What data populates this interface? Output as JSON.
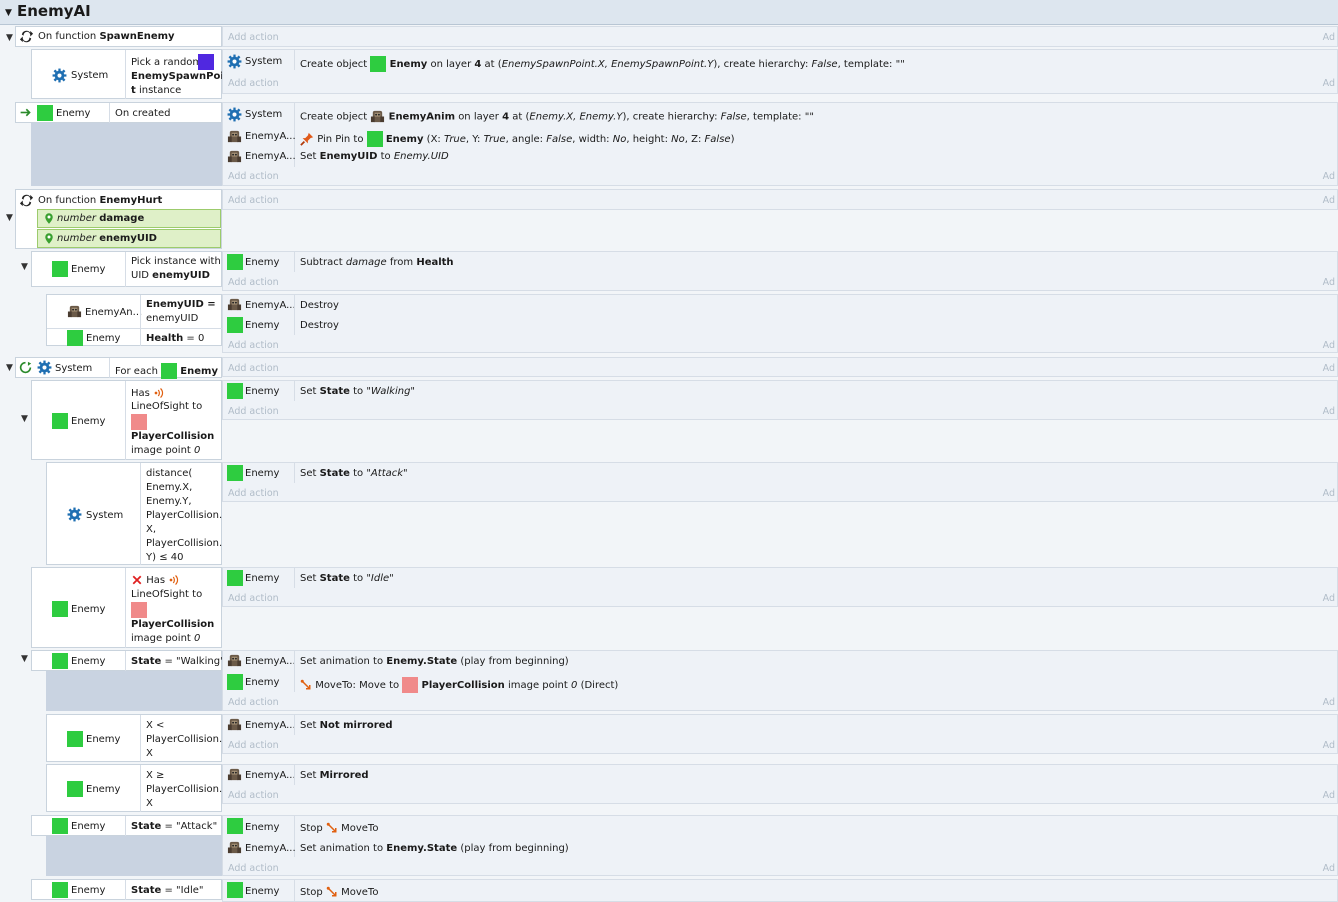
{
  "sheet": {
    "title": "EnemyAI"
  },
  "labels": {
    "add_action": "Add action",
    "add_short": "Ad"
  },
  "objects": {
    "system": "System",
    "enemy": "Enemy",
    "enemy_anim_short": "EnemyA...",
    "enemy_anim_cond": "EnemyAn..."
  },
  "colors": {
    "enemy": "#2ecc40",
    "player_collision": "#f08a8a",
    "spawn_point": "#5028e0",
    "param_bg": "#dff0c8"
  },
  "events": {
    "spawn_fn": {
      "label": "On function",
      "name": "SpawnEnemy"
    },
    "spawn_pick": {
      "pre": "Pick a random",
      "obj": "EnemySpawnPoin",
      "obj2": "t",
      "post": "instance"
    },
    "spawn_action": {
      "pre": "Create object",
      "obj": "Enemy",
      "mid": "on layer",
      "layer": "4",
      "at": "at (",
      "expr": "EnemySpawnPoint.X, EnemySpawnPoint.Y",
      "tail": "), create hierarchy:",
      "hier": "False",
      "tail2": ", template: \"\""
    },
    "on_created": {
      "cond": "On created"
    },
    "created_actions": {
      "a1_pre": "Create object",
      "a1_obj": "EnemyAnim",
      "a1_mid": "on layer",
      "a1_layer": "4",
      "a1_at": "at (",
      "a1_expr": "Enemy.X, Enemy.Y",
      "a1_tail": "), create hierarchy:",
      "a1_hier": "False",
      "a1_tail2": ", template: \"\"",
      "a2_pre": "Pin Pin to",
      "a2_obj": "Enemy",
      "a2_x": "(X:",
      "a2_xv": "True",
      "a2_y": ", Y:",
      "a2_yv": "True",
      "a2_ang": ", angle:",
      "a2_angv": "False",
      "a2_w": ", width:",
      "a2_wv": "No",
      "a2_h": ", height:",
      "a2_hv": "No",
      "a2_z": ", Z:",
      "a2_zv": "False",
      "a2_end": ")",
      "a3_pre": "Set",
      "a3_var": "EnemyUID",
      "a3_to": "to",
      "a3_val": "Enemy.UID"
    },
    "hurt_fn": {
      "label": "On function",
      "name": "EnemyHurt",
      "p1_type": "number",
      "p1_name": "damage",
      "p2_type": "number",
      "p2_name": "enemyUID"
    },
    "pick_uid": {
      "pre": "Pick instance with",
      "pre2": "UID",
      "var": "enemyUID"
    },
    "subtract": {
      "pre": "Subtract",
      "var": "damage",
      "mid": "from",
      "target": "Health"
    },
    "uid_cond": {
      "var": "EnemyUID",
      "eq": " =",
      "val": "enemyUID"
    },
    "health_cond": {
      "var": "Health",
      "eq": " = 0"
    },
    "destroy": "Destroy",
    "foreach": {
      "label": "For each",
      "obj": "Enemy"
    },
    "los": {
      "has": "Has",
      "l2": "LineOfSight to",
      "obj": "PlayerCollision",
      "l4": "image point",
      "pt": "0"
    },
    "set_walking": {
      "pre": "Set",
      "var": "State",
      "to": "to",
      "val": "\"Walking\""
    },
    "distance": {
      "l1": "distance(",
      "l2": "Enemy.X,",
      "l3": "Enemy.Y,",
      "l4": "PlayerCollision.",
      "l5": "X,",
      "l6": "PlayerCollision.",
      "l7": "Y) ≤ 40"
    },
    "set_attack": {
      "pre": "Set",
      "var": "State",
      "to": "to",
      "val": "\"Attack\""
    },
    "set_idle": {
      "pre": "Set",
      "var": "State",
      "to": "to",
      "val": "\"Idle\""
    },
    "state_walking": {
      "var": "State",
      "eq": "= \"Walking\""
    },
    "anim_state": {
      "pre": "Set animation to",
      "expr": "Enemy.State",
      "post": "(play from beginning)"
    },
    "moveto": {
      "pre": "MoveTo: Move to",
      "obj": "PlayerCollision",
      "mid": "image point",
      "pt": "0",
      "post": "(Direct)"
    },
    "x_lt": {
      "l1": "X <",
      "l2": "PlayerCollision.",
      "l3": "X"
    },
    "x_ge": {
      "l1": "X ≥",
      "l2": "PlayerCollision.",
      "l3": "X"
    },
    "not_mirrored": {
      "pre": "Set",
      "val": "Not mirrored"
    },
    "mirrored": {
      "pre": "Set",
      "val": "Mirrored"
    },
    "state_attack": {
      "var": "State",
      "eq": "= \"Attack\""
    },
    "state_idle": {
      "var": "State",
      "eq": "= \"Idle\""
    },
    "stop": {
      "pre": "Stop",
      "obj": "MoveTo"
    }
  }
}
